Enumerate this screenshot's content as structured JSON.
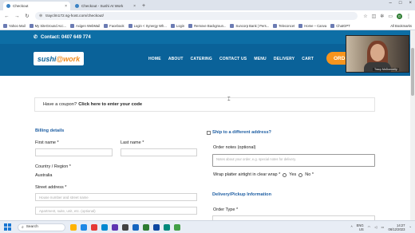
{
  "browser": {
    "tabs": [
      {
        "title": "Checkout",
        "active": true
      },
      {
        "title": "Checkout - Sushi At Work",
        "active": false
      }
    ],
    "new_tab": "+",
    "url": "trayclm172.sg-host.com/checkout/",
    "bookmarks": [
      "Yahoo Mail",
      "My SiteGround Acc...",
      "Axigen WebMail",
      "Facebook",
      "Login < Synergy Wh...",
      "Login",
      "Remove Backgroun...",
      "Suncorp Bank | Pers...",
      "Teleconcet",
      "Home – Canva",
      "ChatGPT"
    ],
    "bookmarks_all": "All Bookmarks"
  },
  "site": {
    "phone": "Contact: 0407 649 774",
    "logo_part1": "sushi",
    "logo_part2": "@work",
    "nav": [
      "HOME",
      "ABOUT",
      "CATERING",
      "CONTACT US",
      "MENU",
      "DELIVERY",
      "CART"
    ],
    "order_button": "ORD"
  },
  "checkout": {
    "coupon_prefix": "Have a coupon?",
    "coupon_link": "Click here to enter your code",
    "billing_title": "Billing details",
    "first_name_label": "First name *",
    "last_name_label": "Last name *",
    "country_label": "Country / Region *",
    "country_value": "Australia",
    "street_label": "Street address *",
    "street_placeholder": "House number and street name",
    "apartment_placeholder": "Apartment, suite, unit, etc. (optional)",
    "ship_different": "Ship to a different address?",
    "order_notes_label": "Order notes (optional)",
    "order_notes_placeholder": "Notes about your order, e.g. special notes for delivery.",
    "wrap_label": "Wrap platter airtight in clear wrap *",
    "wrap_yes": "Yes",
    "wrap_no": "No *",
    "delivery_title": "Delivery/Pickup Information",
    "order_type_label": "Order Type *"
  },
  "video": {
    "participant": "Tracy McDonnelly"
  },
  "taskbar": {
    "search_label": "Search",
    "lang_top": "ENG",
    "lang_bottom": "US",
    "time": "14:27",
    "date": "06/12/2023"
  }
}
